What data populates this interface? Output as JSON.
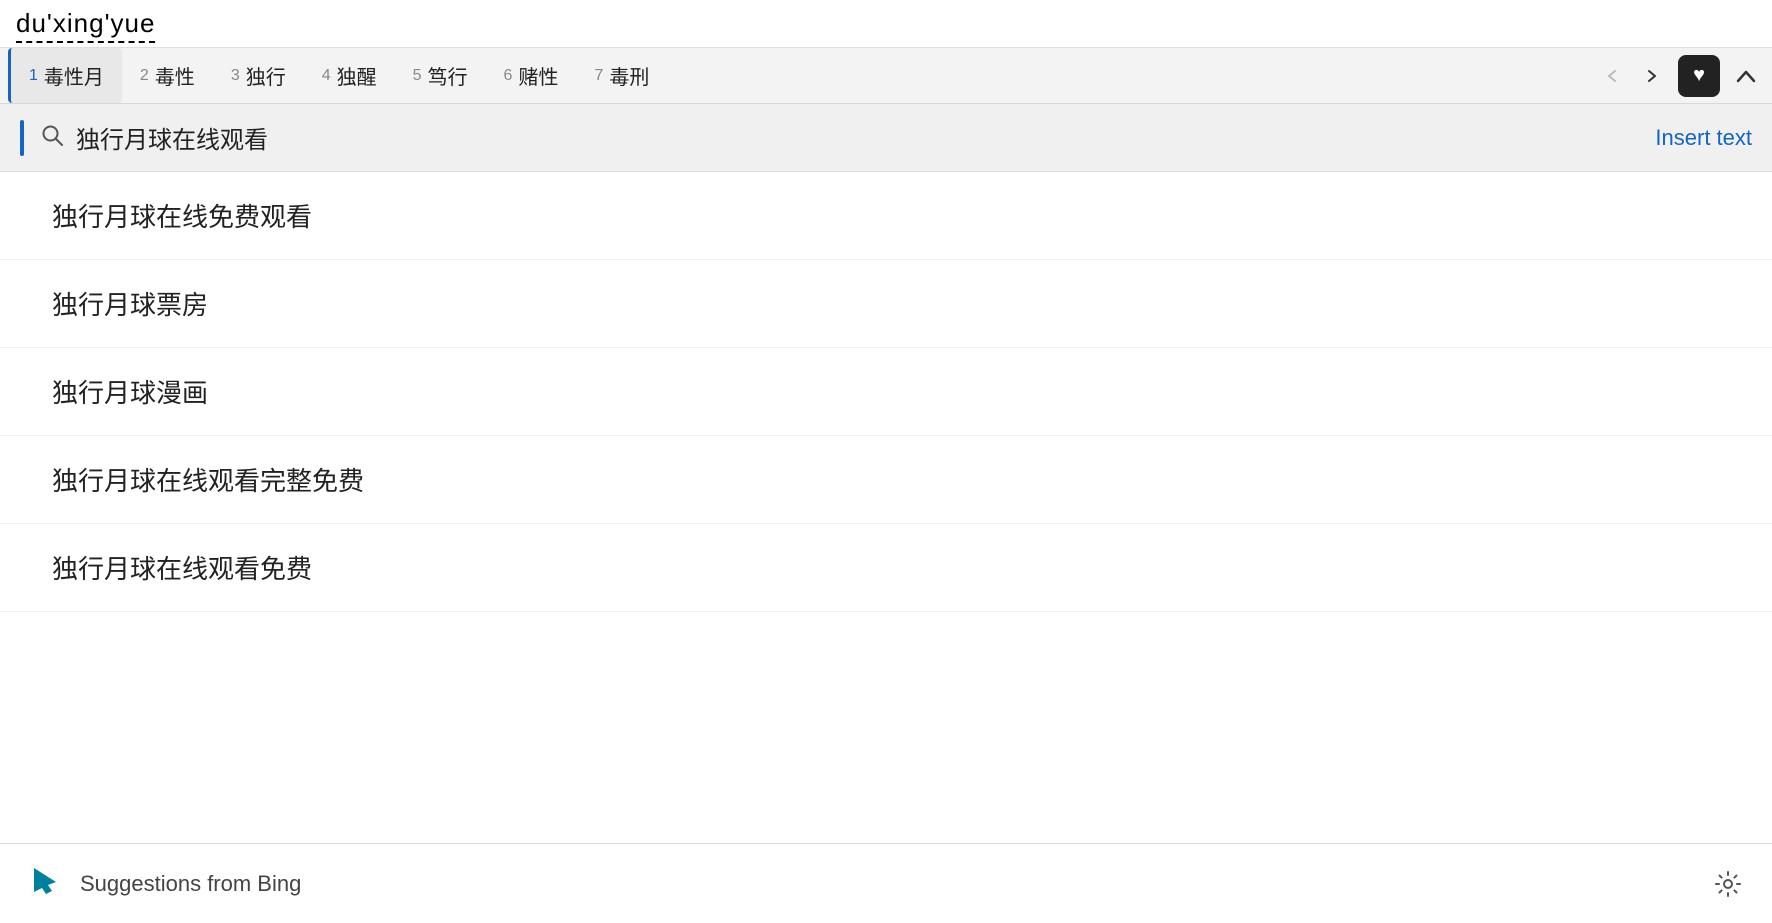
{
  "ime": {
    "input_text": "du'xing'yue"
  },
  "candidates": [
    {
      "num": "1",
      "text": "毒性月",
      "selected": true
    },
    {
      "num": "2",
      "text": "毒性",
      "selected": false
    },
    {
      "num": "3",
      "text": "独行",
      "selected": false
    },
    {
      "num": "4",
      "text": "独醒",
      "selected": false
    },
    {
      "num": "5",
      "text": "笃行",
      "selected": false
    },
    {
      "num": "6",
      "text": "赌性",
      "selected": false
    },
    {
      "num": "7",
      "text": "毒刑",
      "selected": false
    }
  ],
  "search_bar": {
    "query": "独行月球在线观看",
    "insert_text_label": "Insert text"
  },
  "suggestions": [
    "独行月球在线免费观看",
    "独行月球票房",
    "独行月球漫画",
    "独行月球在线观看完整免费",
    "独行月球在线观看免费"
  ],
  "bottom_bar": {
    "label": "Suggestions from Bing"
  },
  "nav": {
    "prev_disabled": true,
    "next_disabled": false
  }
}
